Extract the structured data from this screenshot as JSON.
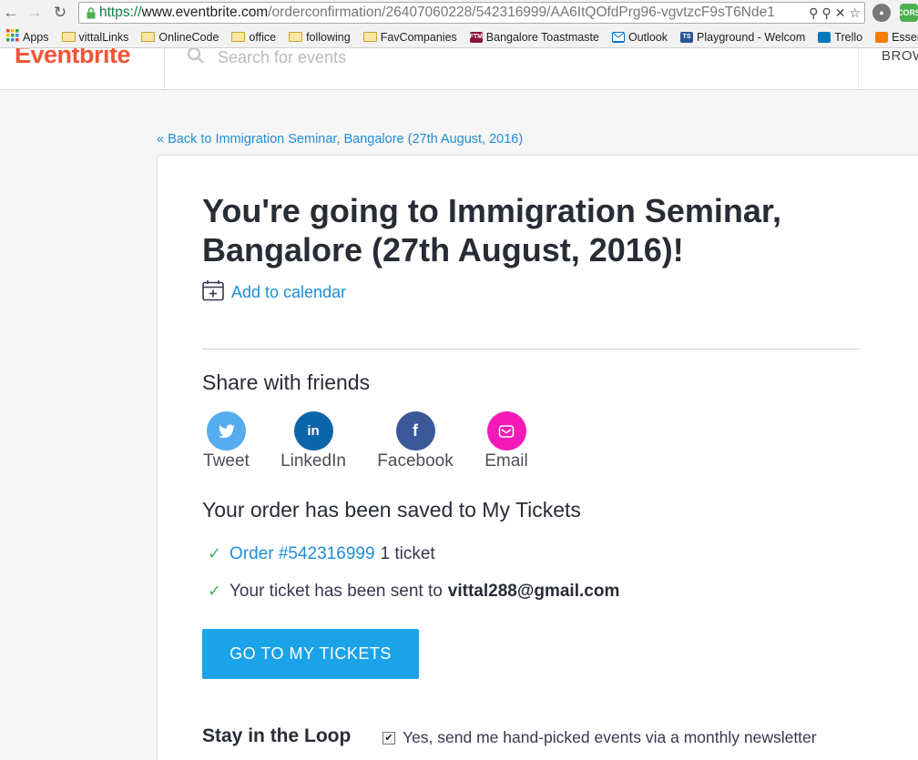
{
  "browser": {
    "url_protocol": "https://",
    "url_host": "www.eventbrite.com",
    "url_path": "/orderconfirmation/26407060228/542316999/AA6ItQOfdPrg96-vgvtzcF9sT6Nde1",
    "bookmarks": [
      {
        "label": "Apps",
        "icon": "apps-grid-icon"
      },
      {
        "label": "vittalLinks",
        "icon": "folder-icon"
      },
      {
        "label": "OnlineCode",
        "icon": "folder-icon"
      },
      {
        "label": "office",
        "icon": "folder-icon"
      },
      {
        "label": "following",
        "icon": "folder-icon"
      },
      {
        "label": "FavCompanies",
        "icon": "folder-icon"
      },
      {
        "label": "Bangalore Toastmaste",
        "icon": "ftm-favicon-icon",
        "icon_text": "FTM"
      },
      {
        "label": "Outlook",
        "icon": "outlook-mail-icon"
      },
      {
        "label": "Playground - Welcom",
        "icon": "ts-favicon-icon",
        "icon_text": "TS"
      },
      {
        "label": "Trello",
        "icon": "trello-icon"
      },
      {
        "label": "Essentially",
        "icon": "blogger-icon"
      }
    ],
    "extension_badge": "CORS"
  },
  "header": {
    "logo": "Eventbrite",
    "search_placeholder": "Search for events",
    "browse_label": "BROW"
  },
  "main": {
    "back_link": "« Back to Immigration Seminar, Bangalore (27th August, 2016)",
    "title": "You're going to Immigration Seminar, Bangalore (27th August, 2016)!",
    "add_to_calendar": "Add to calendar",
    "share_heading": "Share with friends",
    "share_options": [
      {
        "label": "Tweet",
        "glyph": "t",
        "color": "#55acee"
      },
      {
        "label": "LinkedIn",
        "glyph": "in",
        "color": "#0a66a8"
      },
      {
        "label": "Facebook",
        "glyph": "f",
        "color": "#3b5998"
      },
      {
        "label": "Email",
        "glyph": "✉",
        "color": "#f51ab8"
      }
    ],
    "order_heading": "Your order has been saved to My Tickets",
    "order_link": "Order #542316999",
    "order_ticket_count": "1 ticket",
    "ticket_sent_text": "Your ticket has been sent to",
    "ticket_email": "vittal288@gmail.com",
    "cta_button": "GO TO MY TICKETS",
    "loop_heading": "Stay in the Loop",
    "newsletter_label": "Yes, send me hand-picked events via a monthly newsletter",
    "newsletter_checked": true
  }
}
